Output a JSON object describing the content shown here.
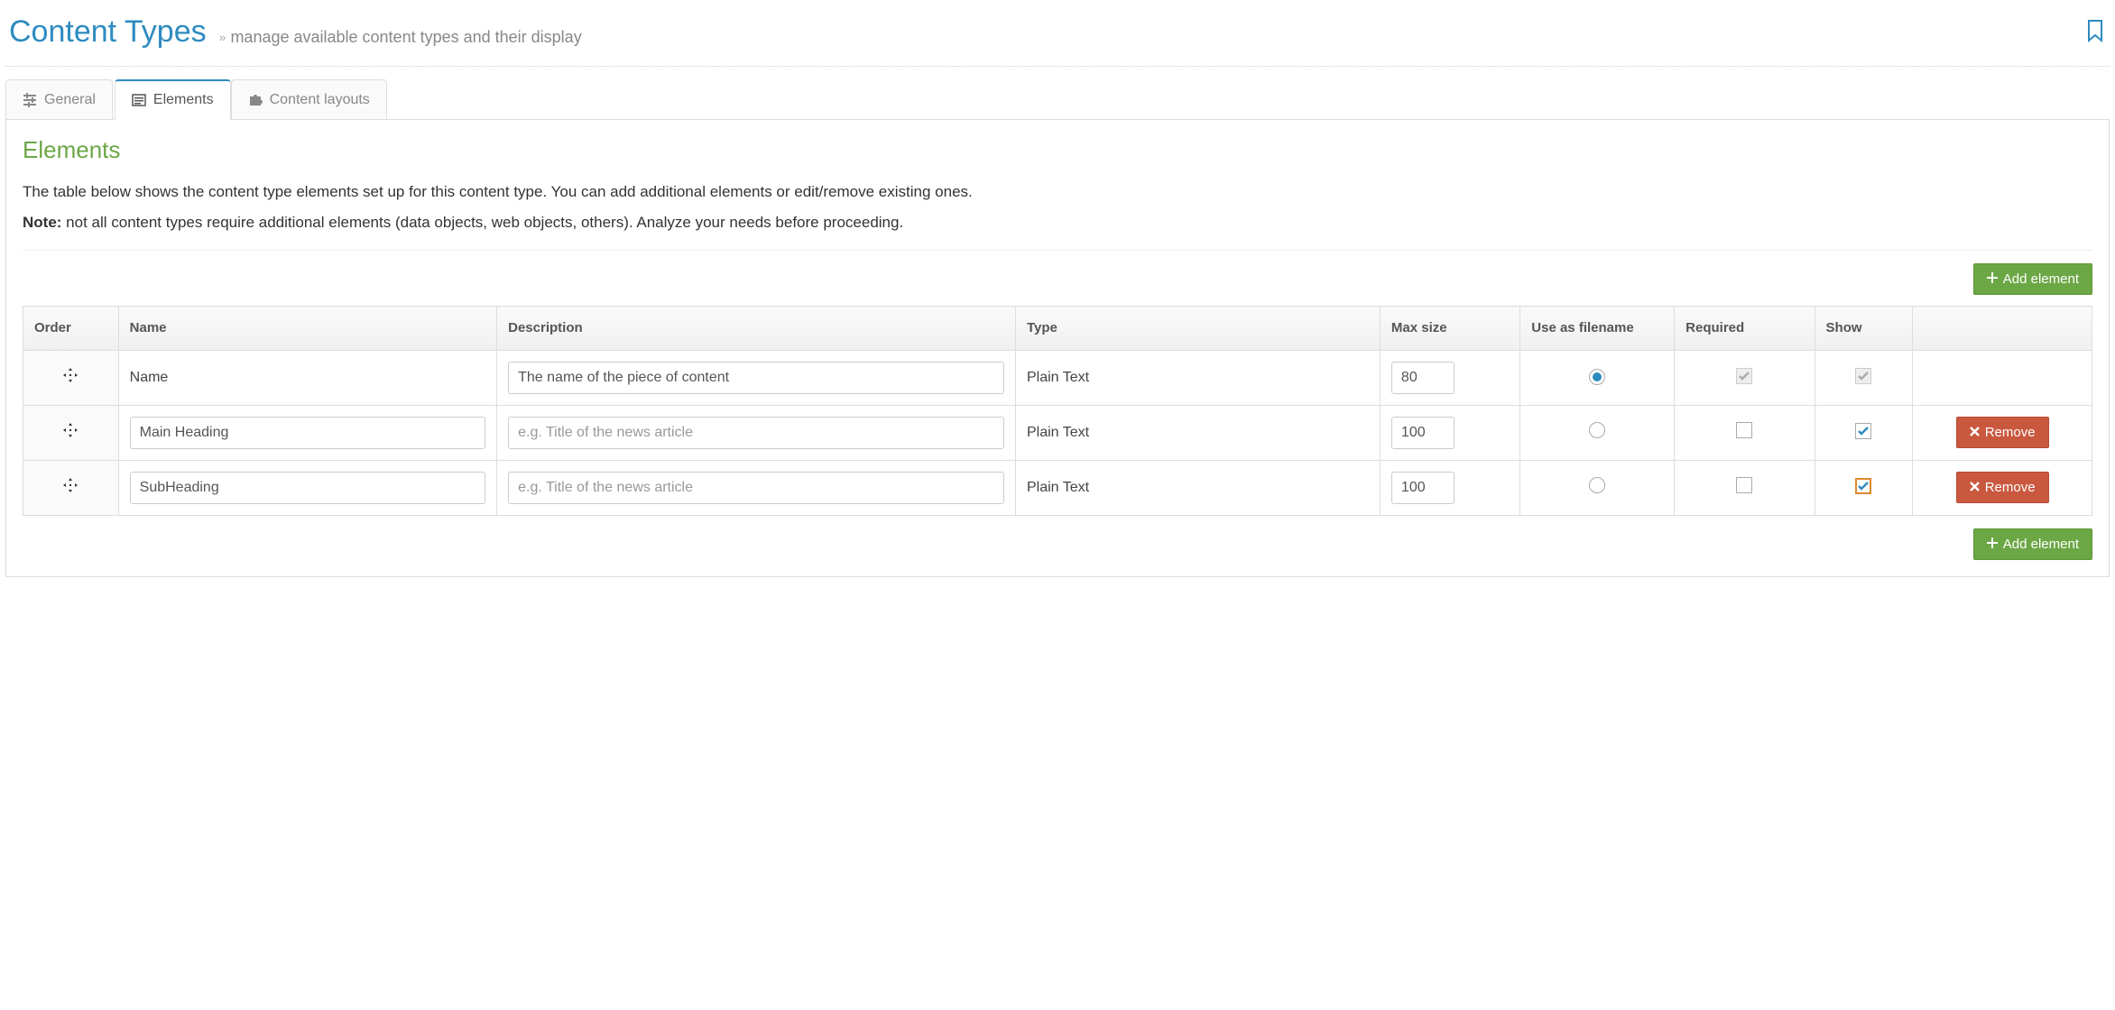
{
  "header": {
    "title": "Content Types",
    "subtitle": "manage available content types and their display"
  },
  "tabs": [
    {
      "label": "General",
      "active": false
    },
    {
      "label": "Elements",
      "active": true
    },
    {
      "label": "Content layouts",
      "active": false
    }
  ],
  "section": {
    "title": "Elements",
    "intro_line1": "The table below shows the content type elements set up for this content type. You can add additional elements or edit/remove existing ones.",
    "intro_note_label": "Note:",
    "intro_note_text": " not all content types require additional elements (data objects, web objects, others). Analyze your needs before proceeding."
  },
  "buttons": {
    "add_element": "Add element",
    "remove": "Remove"
  },
  "table": {
    "headers": {
      "order": "Order",
      "name": "Name",
      "description": "Description",
      "type": "Type",
      "max_size": "Max size",
      "use_as_filename": "Use as filename",
      "required": "Required",
      "show": "Show"
    },
    "rows": [
      {
        "builtin": true,
        "name_label": "Name",
        "description_value": "The name of the piece of content",
        "description_placeholder": "",
        "type": "Plain Text",
        "max_size": "80",
        "use_as_filename": true,
        "required_checked": true,
        "required_disabled": true,
        "show_checked": true,
        "show_disabled": true,
        "show_highlighted": false,
        "removable": false
      },
      {
        "builtin": false,
        "name_value": "Main Heading",
        "name_placeholder": "",
        "description_value": "",
        "description_placeholder": "e.g. Title of the news article",
        "type": "Plain Text",
        "max_size": "100",
        "use_as_filename": false,
        "required_checked": false,
        "required_disabled": false,
        "show_checked": true,
        "show_disabled": false,
        "show_highlighted": false,
        "removable": true
      },
      {
        "builtin": false,
        "name_value": "SubHeading",
        "name_placeholder": "",
        "description_value": "",
        "description_placeholder": "e.g. Title of the news article",
        "type": "Plain Text",
        "max_size": "100",
        "use_as_filename": false,
        "required_checked": false,
        "required_disabled": false,
        "show_checked": true,
        "show_disabled": false,
        "show_highlighted": true,
        "removable": true
      }
    ]
  }
}
